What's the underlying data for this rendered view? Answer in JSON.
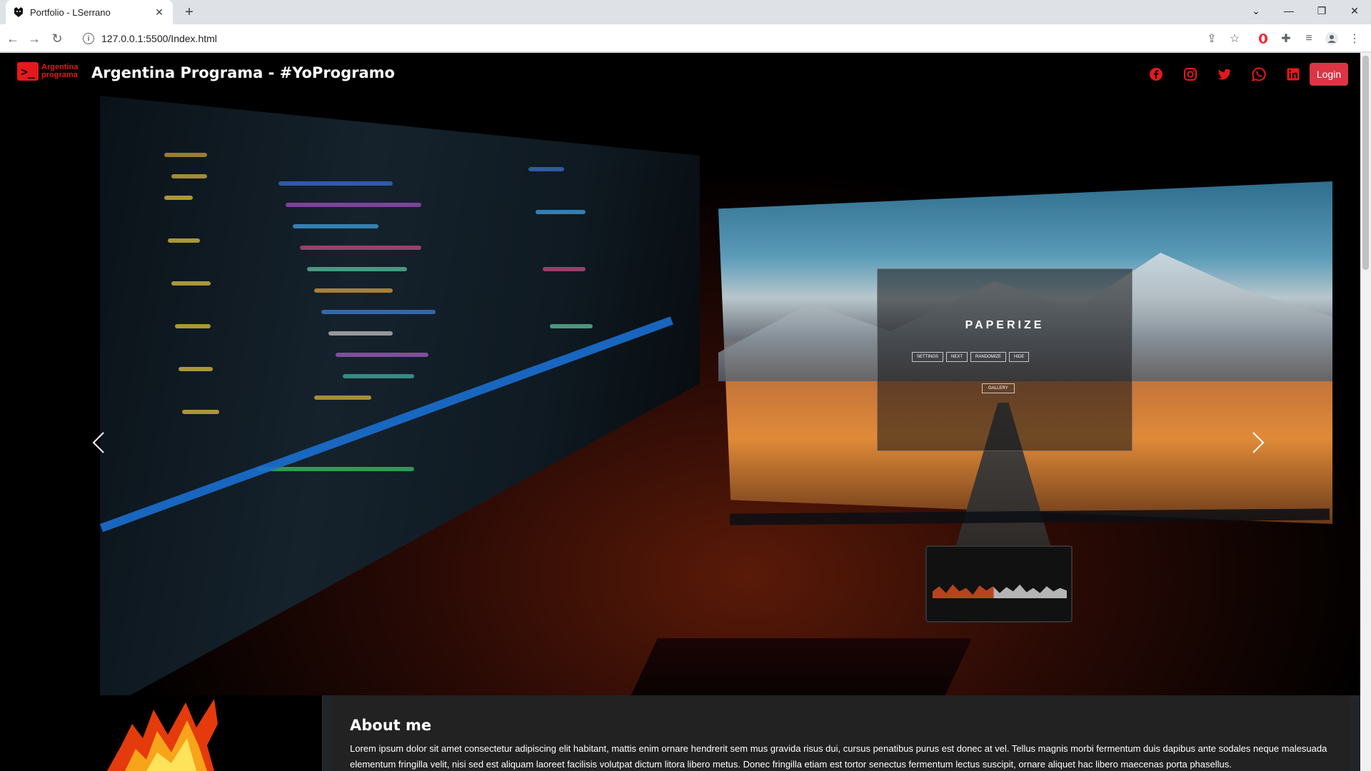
{
  "browser": {
    "tab_title": "Portfolio - LSerrano",
    "url": "127.0.0.1:5500/Index.html",
    "icons": [
      "back-arrow-icon",
      "forward-arrow-icon",
      "reload-icon",
      "site-info-icon",
      "share-icon",
      "bookmark-star-icon",
      "opera-icon",
      "extensions-icon",
      "reading-list-icon",
      "profile-icon",
      "menu-kebab-icon"
    ]
  },
  "site": {
    "logo_text_line1": "Argentina",
    "logo_text_line2": "programa",
    "title": "Argentina Programa - #YoProgramo",
    "social_icons": [
      "facebook-icon",
      "instagram-icon",
      "twitter-icon",
      "whatsapp-icon",
      "linkedin-icon"
    ],
    "login_label": "Login",
    "accent_color": "#e5191c"
  },
  "carousel": {
    "slide_count": 4,
    "active_index": 0,
    "screen_title": "PAPERIZE",
    "screen_buttons": [
      "SETTINGS",
      "NEXT",
      "RANDOMIZE",
      "HIDE"
    ],
    "screen_gallery": "GALLERY"
  },
  "about": {
    "title": "About me",
    "text": "Lorem ipsum dolor sit amet consectetur adipiscing elit habitant, mattis enim ornare hendrerit sem mus gravida risus dui, cursus penatibus purus est donec at vel. Tellus magnis morbi fermentum duis dapibus ante sodales neque malesuada elementum fringilla velit, nisi sed est aliquam laoreet facilisis volutpat dictum litora libero metus. Donec fringilla etiam est tortor senectus fermentum lectus suscipit, ornare aliquet hac libero maecenas porta phasellus."
  }
}
